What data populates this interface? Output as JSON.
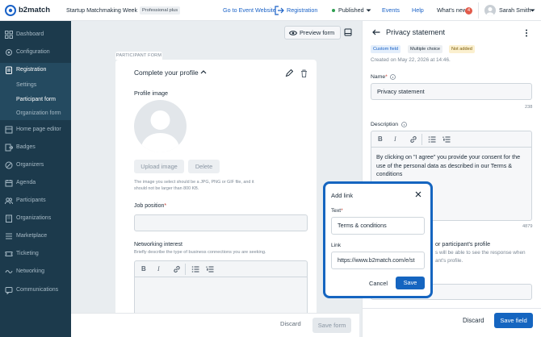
{
  "brand": {
    "name": "b2match",
    "accent": "#1a62c7",
    "sidebar_bg": "#1c3a4c"
  },
  "topbar": {
    "event_name": "Startup Matchmaking Week",
    "plan_badge": "Professional plus",
    "go_to_event": "Go to Event Website",
    "registration": "Registration",
    "status": "Published",
    "events": "Events",
    "help": "Help",
    "whats_new": "What's new",
    "whats_new_count": "4",
    "user_name": "Sarah Smith"
  },
  "sidebar": {
    "items": [
      {
        "label": "Dashboard",
        "icon": "grid-icon"
      },
      {
        "label": "Configuration",
        "icon": "gear-icon"
      },
      {
        "label": "Registration",
        "icon": "clipboard-icon"
      },
      {
        "label": "Settings"
      },
      {
        "label": "Participant form"
      },
      {
        "label": "Organization form"
      },
      {
        "label": "Home page editor",
        "icon": "home-icon"
      },
      {
        "label": "Badges",
        "icon": "badge-icon"
      },
      {
        "label": "Organizers",
        "icon": "organizers-icon"
      },
      {
        "label": "Agenda",
        "icon": "calendar-icon"
      },
      {
        "label": "Participants",
        "icon": "people-icon"
      },
      {
        "label": "Organizations",
        "icon": "building-icon"
      },
      {
        "label": "Marketplace",
        "icon": "store-icon"
      },
      {
        "label": "Ticketing",
        "icon": "ticket-icon"
      },
      {
        "label": "Networking",
        "icon": "network-icon"
      },
      {
        "label": "Communications",
        "icon": "chat-icon"
      }
    ]
  },
  "form": {
    "preview_label": "Preview form",
    "section_tag": "PARTICIPANT FORM",
    "section_title": "Complete your profile",
    "profile_image_label": "Profile image",
    "upload_label": "Upload image",
    "delete_label": "Delete",
    "image_hint": "The image you select should be a JPG, PNG or GIF file, and it should not be larger than 800 KB.",
    "job_position_label": "Job position",
    "networking_label": "Networking interest",
    "networking_hint": "Briefly describe the type of business connections you are seeking.",
    "discard_label": "Discard",
    "save_label": "Save form"
  },
  "panel": {
    "title": "Privacy statement",
    "chips": [
      "Custom field",
      "Multiple choice",
      "Not added"
    ],
    "created": "Created on May 22, 2026 at 14:46.",
    "name_label": "Name",
    "name_value": "Privacy statement",
    "name_count": "238",
    "description_label": "Description",
    "description_text": "By clicking on \"I agree\" you provide your consent for the use of the personal data as described in our",
    "description_link": "Terms & conditions",
    "description_count": "4879",
    "visibility_fragment": "or participant's profile",
    "visibility_hint_a": "s will be able to see the response when",
    "visibility_hint_b": "ant's profile.",
    "discard_label": "Discard",
    "save_label": "Save field"
  },
  "modal": {
    "title": "Add link",
    "text_label": "Text",
    "text_value": "Terms & conditions",
    "link_label": "Link",
    "link_value": "https://www.b2match.com/e/st",
    "cancel_label": "Cancel",
    "save_label": "Save"
  }
}
